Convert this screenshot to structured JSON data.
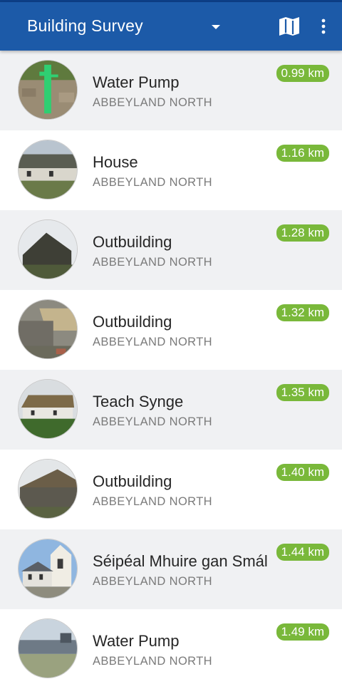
{
  "app_bar": {
    "title": "Building Survey",
    "dropdown_icon": "caret-down-icon",
    "map_icon": "map-icon",
    "menu_icon": "overflow-menu-icon",
    "background": "#1c5aa8"
  },
  "colors": {
    "distance_badge": "#79b83a",
    "row_alt": "#f0f1f3"
  },
  "items": [
    {
      "title": "Water Pump",
      "location": "ABBEYLAND NORTH",
      "distance": "0.99 km"
    },
    {
      "title": "House",
      "location": "ABBEYLAND NORTH",
      "distance": "1.16 km"
    },
    {
      "title": "Outbuilding",
      "location": "ABBEYLAND NORTH",
      "distance": "1.28 km"
    },
    {
      "title": "Outbuilding",
      "location": "ABBEYLAND NORTH",
      "distance": "1.32 km"
    },
    {
      "title": "Teach Synge",
      "location": "ABBEYLAND NORTH",
      "distance": "1.35 km"
    },
    {
      "title": "Outbuilding",
      "location": "ABBEYLAND NORTH",
      "distance": "1.40 km"
    },
    {
      "title": "Séipéal Mhuire gan Smál",
      "location": "ABBEYLAND NORTH",
      "distance": "1.44 km"
    },
    {
      "title": "Water Pump",
      "location": "ABBEYLAND NORTH",
      "distance": "1.49 km"
    }
  ]
}
